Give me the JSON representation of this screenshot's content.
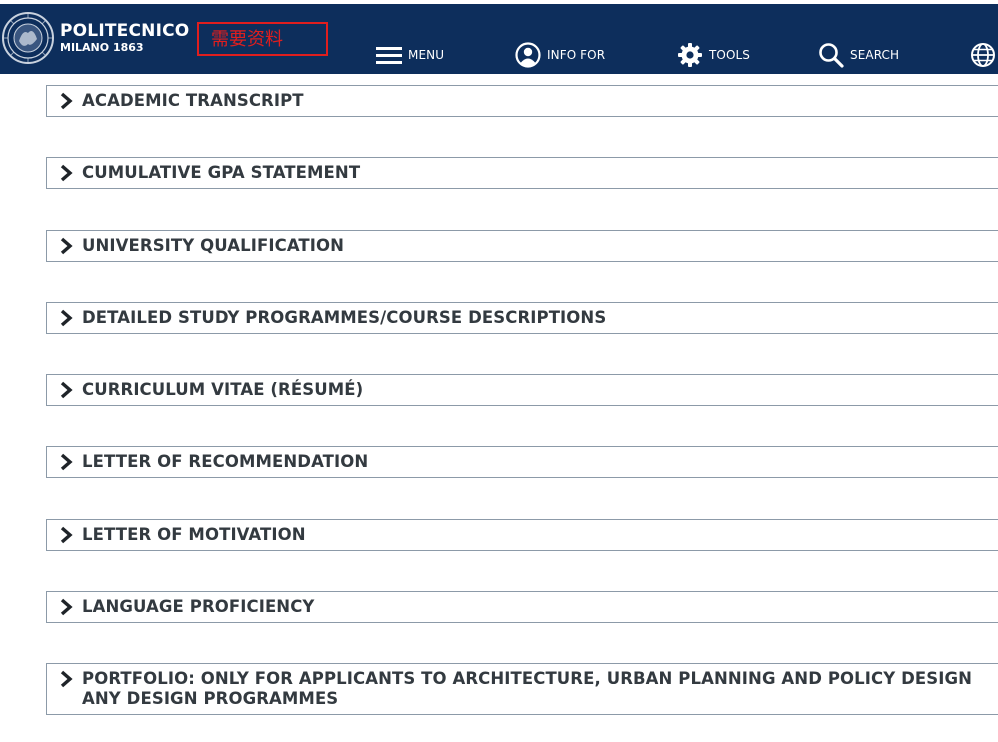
{
  "header": {
    "brand_title": "POLITECNICO",
    "brand_subtitle": "MILANO 1863",
    "annotation_text": "需要资料",
    "annotation_color": "#e01e1e",
    "background_color": "#0d2e5c",
    "nav": {
      "menu": {
        "label": "MENU",
        "icon": "hamburger-icon"
      },
      "info_for": {
        "label": "INFO FOR",
        "icon": "user-circle-icon"
      },
      "tools": {
        "label": "TOOLS",
        "icon": "gear-icon"
      },
      "search": {
        "label": "SEARCH",
        "icon": "search-icon"
      },
      "language": {
        "icon": "globe-icon"
      }
    }
  },
  "accordion": {
    "chevron_icon": "chevron-right-icon",
    "items": [
      {
        "label": "ACADEMIC TRANSCRIPT"
      },
      {
        "label": "CUMULATIVE GPA STATEMENT"
      },
      {
        "label": "UNIVERSITY QUALIFICATION"
      },
      {
        "label": "DETAILED STUDY PROGRAMMES/COURSE DESCRIPTIONS"
      },
      {
        "label": "CURRICULUM VITAE (RÉSUMÉ)"
      },
      {
        "label": "LETTER OF RECOMMENDATION"
      },
      {
        "label": "LETTER OF MOTIVATION"
      },
      {
        "label": "LANGUAGE PROFICIENCY"
      },
      {
        "label": "PORTFOLIO: ONLY FOR APPLICANTS TO ARCHITECTURE, URBAN PLANNING AND POLICY DESIGN ANY DESIGN PROGRAMMES"
      }
    ]
  }
}
